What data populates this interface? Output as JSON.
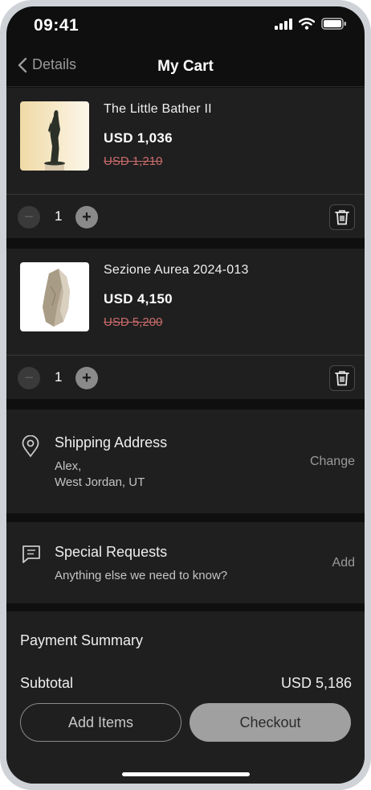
{
  "status_bar": {
    "time": "09:41"
  },
  "nav": {
    "back_label": "Details",
    "title": "My Cart"
  },
  "cart_items": [
    {
      "name": "The Little Bather II",
      "price": "USD 1,036",
      "original_price": "USD 1,210",
      "quantity": "1"
    },
    {
      "name": "Sezione Aurea 2024-013",
      "price": "USD 4,150",
      "original_price": "USD 5,200",
      "quantity": "1"
    }
  ],
  "qty_controls": {
    "minus": "−",
    "plus": "+"
  },
  "shipping": {
    "title": "Shipping Address",
    "name_line": "Alex,",
    "city_line": "West Jordan, UT",
    "action": "Change"
  },
  "special_requests": {
    "title": "Special Requests",
    "placeholder": "Anything else we need to know?",
    "action": "Add"
  },
  "payment": {
    "title": "Payment Summary",
    "subtotal_label": "Subtotal",
    "subtotal_value": "USD 5,186"
  },
  "buttons": {
    "add_items": "Add Items",
    "checkout": "Checkout"
  },
  "colors": {
    "background": "#0f0f0f",
    "card": "#1f1f1f",
    "strike_price": "#c96a6a",
    "checkout_bg": "#a0a0a0"
  }
}
